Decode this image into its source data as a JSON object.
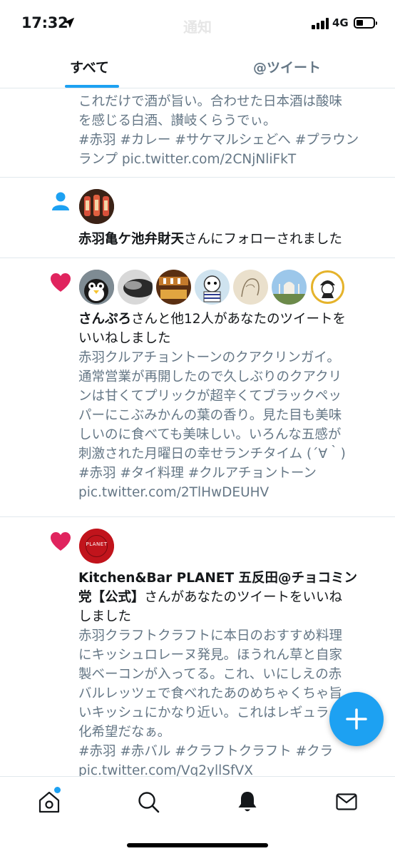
{
  "status_bar": {
    "time": "17:32",
    "network": "4G",
    "title": "通知",
    "location_icon": "location-arrow-icon"
  },
  "tabs": [
    {
      "label": "すべて",
      "active": true
    },
    {
      "label": "@ツイート",
      "active": false
    }
  ],
  "notifications": [
    {
      "type": "tweet-continuation",
      "text": "これだけで酒が旨い。合わせた日本酒は酸味\nを感じる白酒、讃岐くらうでぃ。\n#赤羽 #カレー #サケマルシェどへ #プラウン\nランプ pic.twitter.com/2CNjNliFkT"
    },
    {
      "type": "follow",
      "icon": "person-icon",
      "name": "赤羽亀ケ池弁財天",
      "action": "さんにフォローされました"
    },
    {
      "type": "like",
      "icon": "heart-icon",
      "name": "さんぷろ",
      "action": "さんと他12人があなたのツイートを\nいいねしました",
      "tweet": "赤羽クルアチョントーンのクアクリンガイ。\n通常営業が再開したので久しぶりのクアクリ\nンは甘くてプリックが超辛くてブラックペッ\nパーにこぶみかんの葉の香り。見た目も美味\nしいのに食べても美味しい。いろんな五感が\n刺激された月曜日の幸せランチタイム (´∀｀)\n#赤羽 #タイ料理 #クルアチョントーン\npic.twitter.com/2TlHwDEUHV",
      "avatar_count": 7
    },
    {
      "type": "like",
      "icon": "heart-icon",
      "name": "Kitchen&Bar PLANET 五反田@チョコミン\n党【公式】",
      "action": "さんがあなたのツイートをいいね\nしました",
      "avatar_text": "PLANET",
      "tweet": "赤羽クラフトクラフトに本日のおすすめ料理\nにキッシュロレーヌ発見。ほうれん草と自家\n製ベーコンが入ってる。これ、いにしえの赤\nバルレッツェで食べれたあのめちゃくちゃ旨\nいキッシュにかなり近い。これはレギュラー\n化希望だなぁ。\n#赤羽 #赤バル #クラフトクラフト #クラ\npic.twitter.com/Vq2yllSfVX"
    }
  ],
  "colors": {
    "accent": "#1da1f2",
    "like": "#e0245e",
    "secondary_text": "#657786"
  },
  "bottom_nav": [
    {
      "icon": "home-icon",
      "has_badge": true
    },
    {
      "icon": "search-icon"
    },
    {
      "icon": "bell-icon",
      "active": true
    },
    {
      "icon": "mail-icon"
    }
  ],
  "fab": {
    "icon": "plus-icon"
  }
}
